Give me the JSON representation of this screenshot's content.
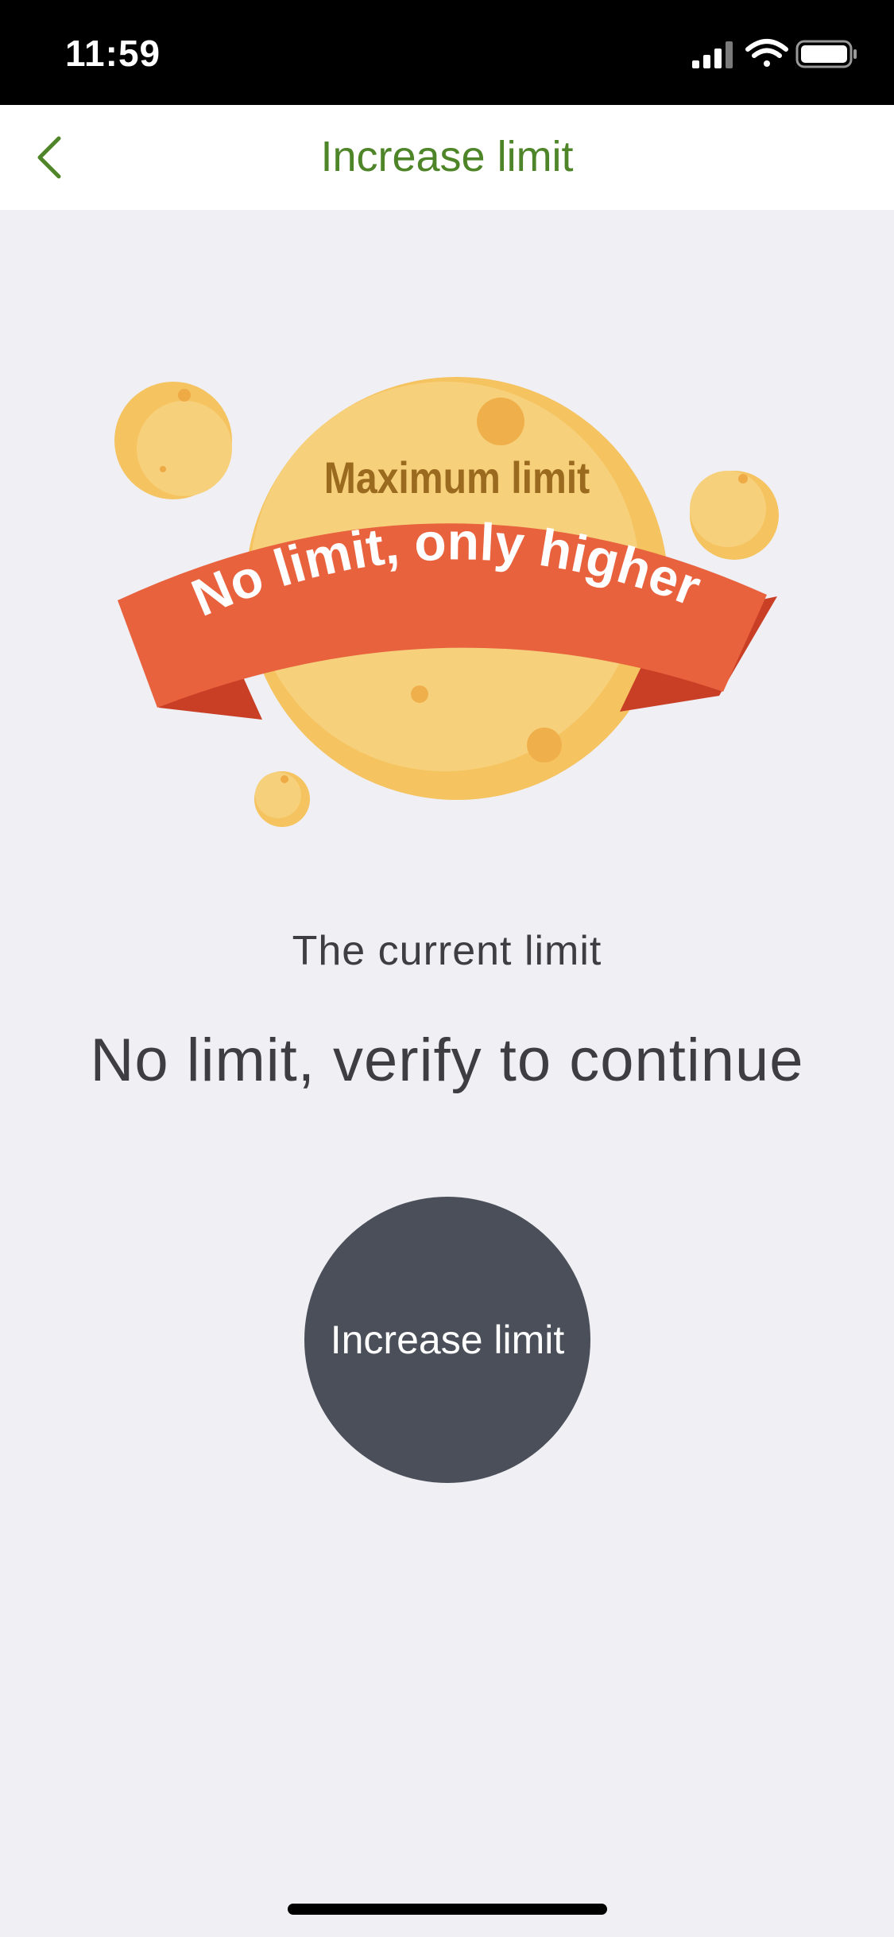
{
  "status_bar": {
    "time": "11:59",
    "icons": [
      "signal-icon",
      "wifi-icon",
      "battery-icon"
    ]
  },
  "nav": {
    "title": "Increase limit",
    "back_icon": "chevron-left-icon",
    "accent_color": "#4f8529"
  },
  "hero": {
    "caption": "Maximum limit",
    "banner": "No limit, only higher",
    "planet_color": "#f5c463",
    "ribbon_color": "#e8623e"
  },
  "limit": {
    "label": "The current limit",
    "value": "No limit, verify to continue"
  },
  "action": {
    "button_label": "Increase limit",
    "button_color": "#4a4f59"
  }
}
